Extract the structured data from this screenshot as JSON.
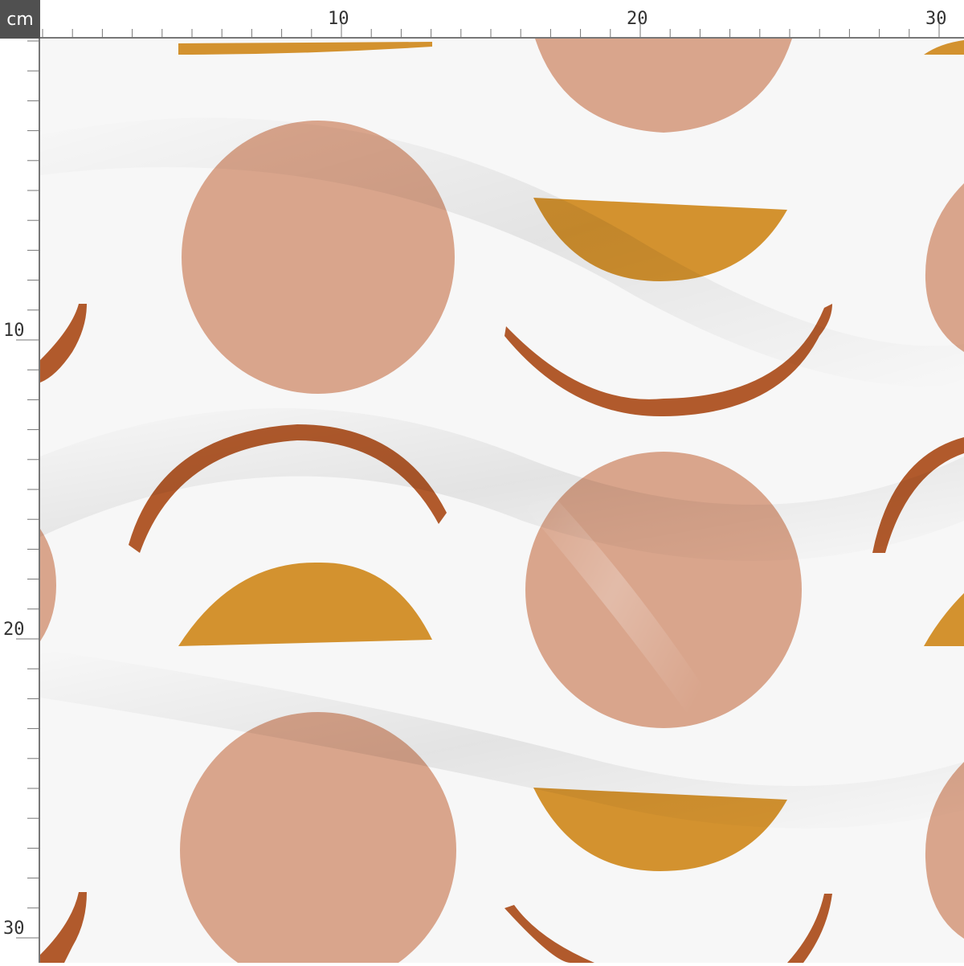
{
  "ruler": {
    "unit_label": "cm",
    "top_labels": [
      "10",
      "20",
      "30"
    ],
    "left_labels": [
      "10",
      "20",
      "30"
    ]
  },
  "pattern": {
    "colors": {
      "background": "#f7f7f7",
      "pink_circle": "#d9a58c",
      "mustard": "#d3922f",
      "rust": "#b15a2c",
      "ruler_dark": "#505050"
    }
  }
}
